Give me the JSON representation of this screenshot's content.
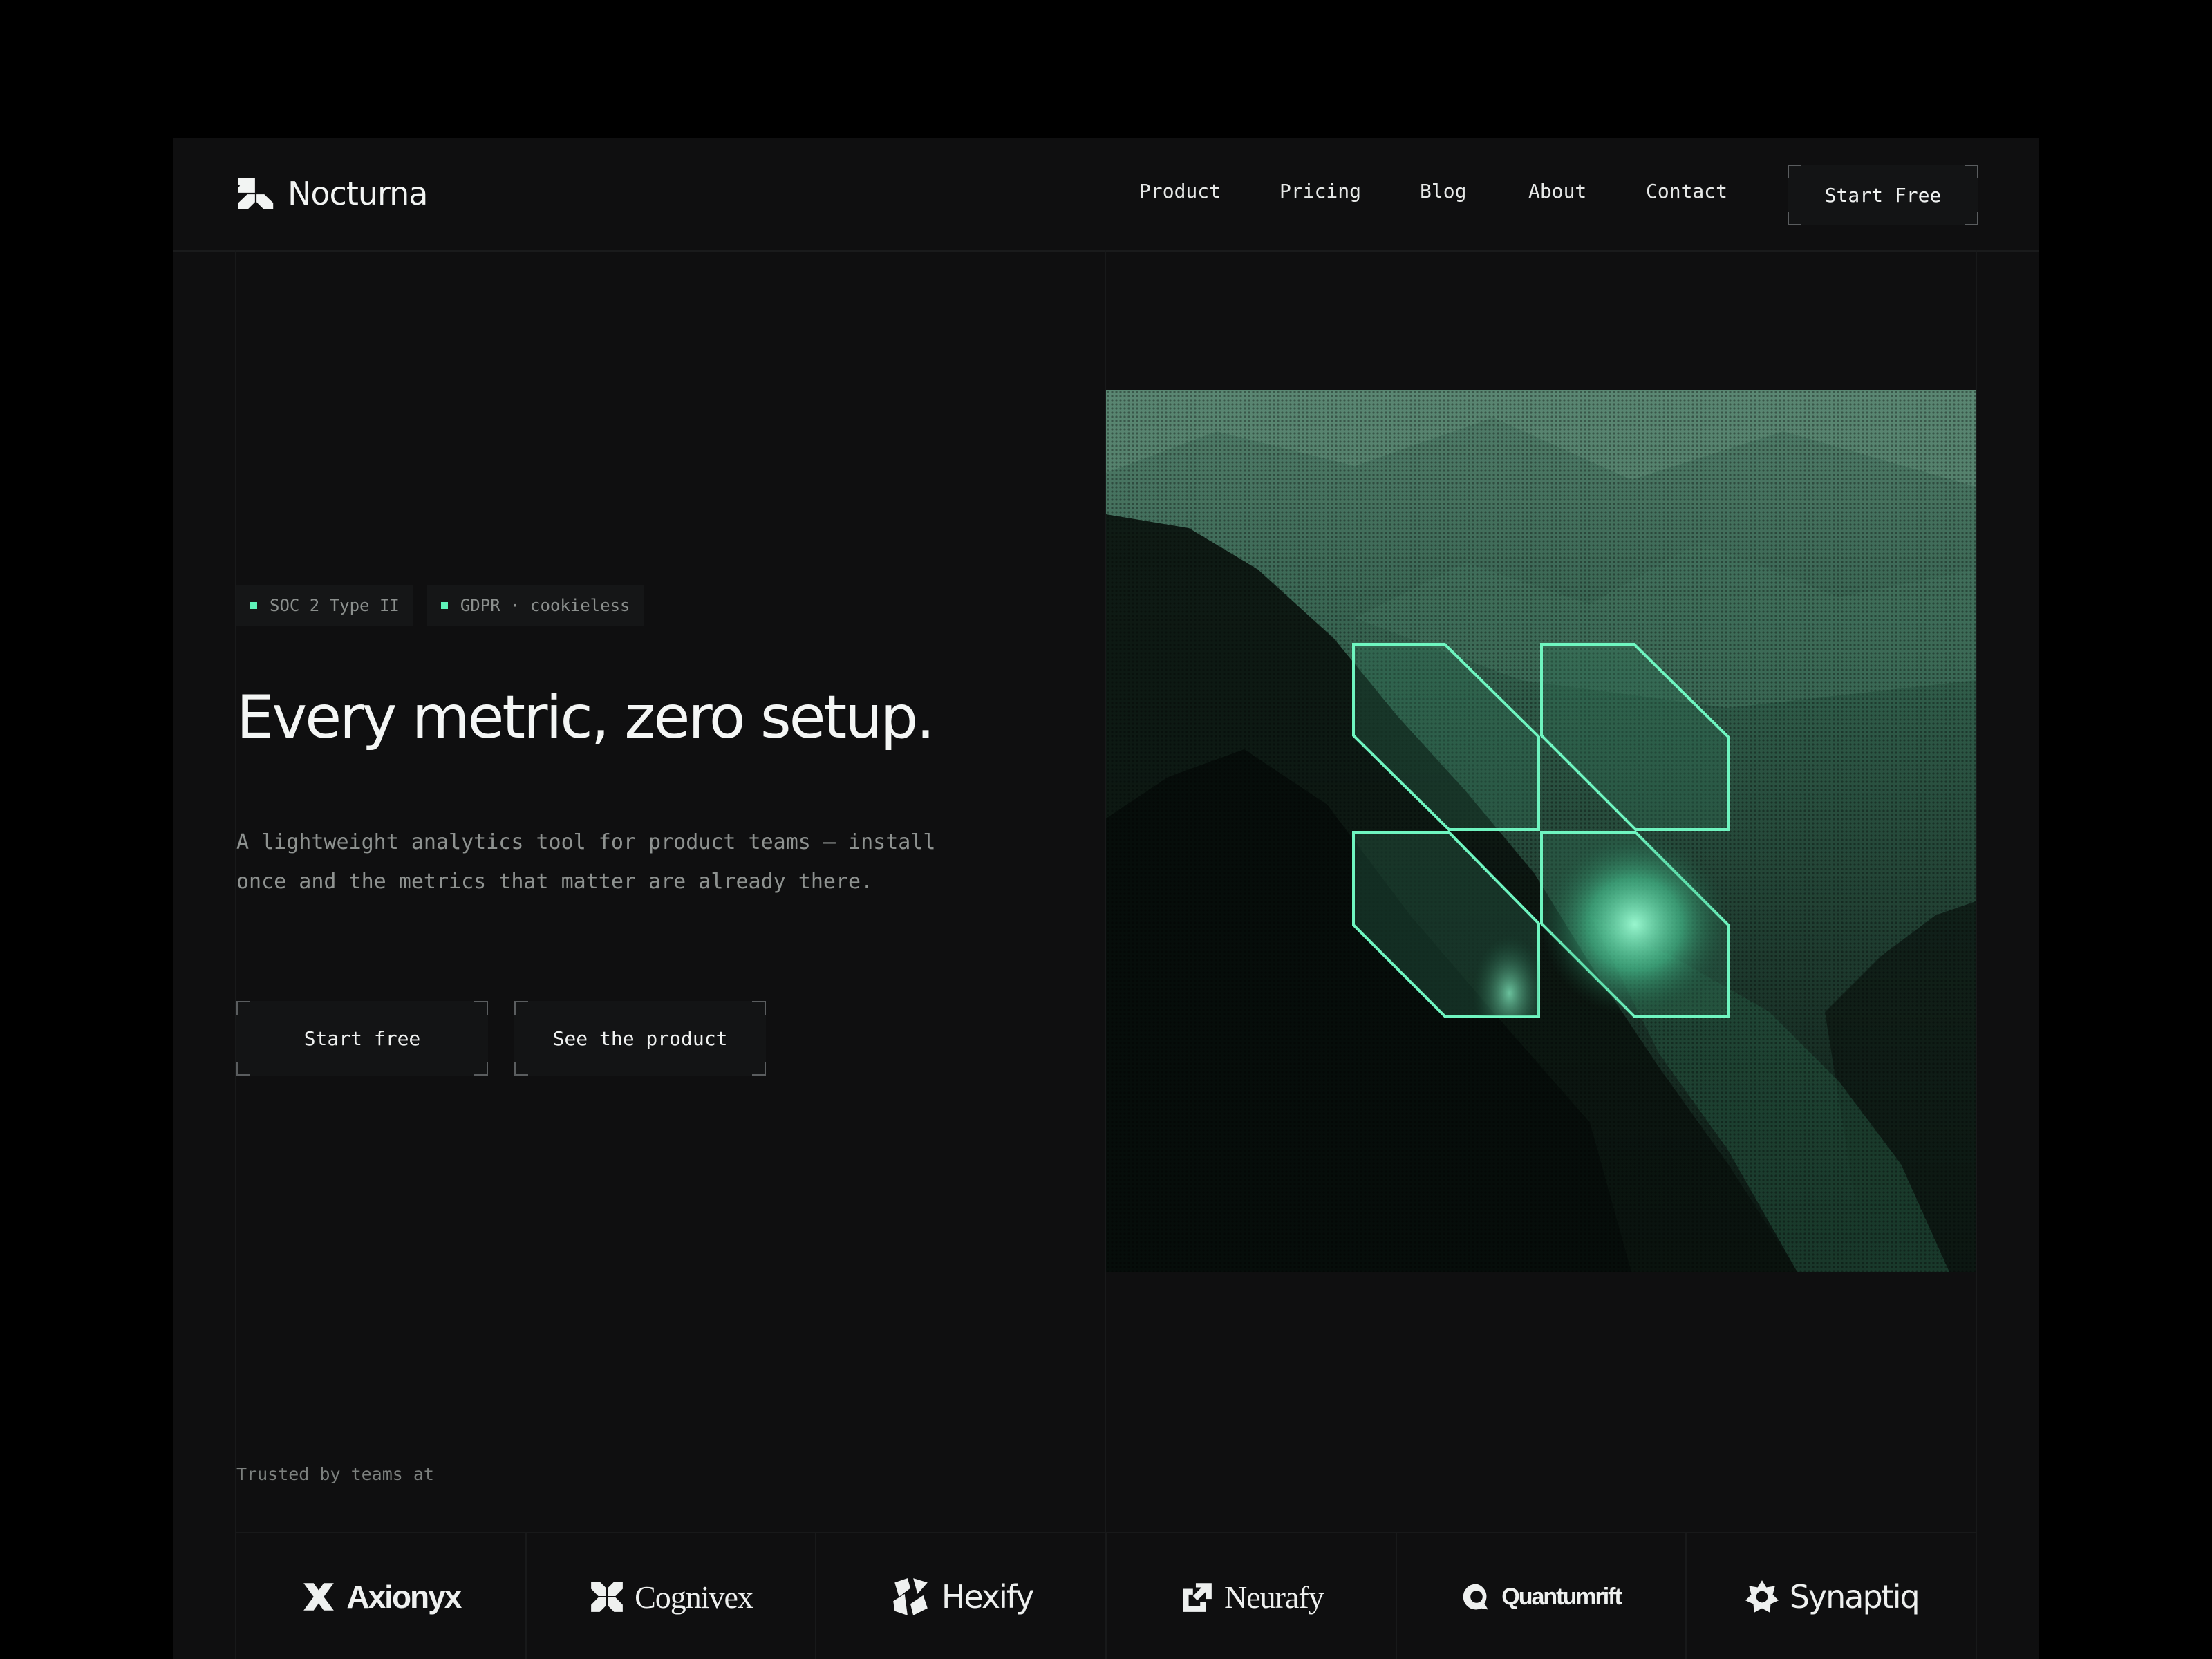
{
  "brand": {
    "name": "Nocturna",
    "icon": "clover-icon"
  },
  "nav": {
    "items": [
      {
        "label": "Product"
      },
      {
        "label": "Pricing"
      },
      {
        "label": "Blog"
      },
      {
        "label": "About"
      },
      {
        "label": "Contact"
      }
    ],
    "cta_label": "Start Free"
  },
  "hero": {
    "badges": [
      {
        "label": "SOC 2 Type II"
      },
      {
        "label": "GDPR · cookieless"
      }
    ],
    "headline": "Every metric, zero setup.",
    "subtext": "A lightweight analytics tool for product teams — install once and the metrics that matter are already there.",
    "primary_cta": "Start free",
    "secondary_cta": "See the product",
    "image_icon": "clover-logo-over-mountain-image"
  },
  "trusted": {
    "label": "Trusted by teams at",
    "logos": [
      {
        "name": "Axionyx",
        "icon": "x-shape-icon"
      },
      {
        "name": "Cognivex",
        "icon": "clover-icon"
      },
      {
        "name": "Hexify",
        "icon": "hex-slash-icon"
      },
      {
        "name": "Neurafy",
        "icon": "square-arrow-icon"
      },
      {
        "name": "Quantumrift",
        "icon": "q-shape-icon"
      },
      {
        "name": "Synaptiq",
        "icon": "gear-star-icon"
      }
    ]
  },
  "colors": {
    "background": "#000000",
    "page": "#0f0f10",
    "accent": "#5ff2b9",
    "text": "#f4f6f5",
    "muted": "#8e9290"
  }
}
